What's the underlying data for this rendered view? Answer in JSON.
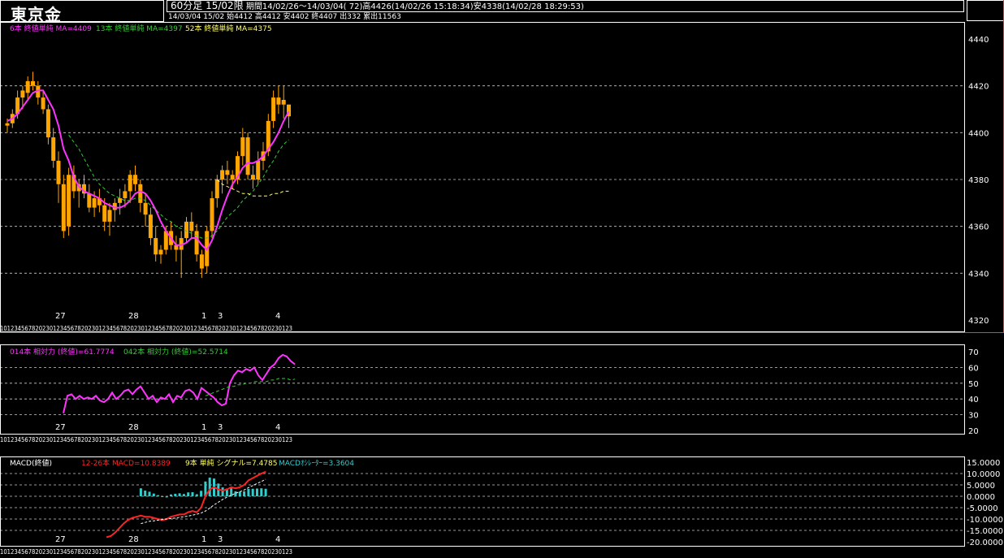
{
  "header": {
    "title": "東京金",
    "timeframe": "60分足 15/02限",
    "period_info": "期間14/02/26〜14/03/04( 72)高4426(14/02/26 15:18:34)安4338(14/02/28 18:29:53)",
    "bar_info": "14/03/04 15/02 始4412 高4412 安4402 終4407 出332 累出11563"
  },
  "colors": {
    "background": "#000000",
    "candle": "#ffa500",
    "ma6": "#ff33ff",
    "ma13": "#33cc33",
    "ma52": "#ffff66",
    "grid": "#ffffff",
    "panel_border_main": "#ff3333",
    "macd_line": "#ff2222",
    "signal_line": "#ffffff",
    "osc_bar": "#33cccc"
  },
  "main_panel": {
    "legend": {
      "ma6": "6本 終値単純 MA=4409",
      "ma13": "13本 終値単純 MA=4397",
      "ma52": "52本 終値単純 MA=4375"
    },
    "y_labels": [
      "4440",
      "4420",
      "4400",
      "4380",
      "4360",
      "4340",
      "4320"
    ],
    "date_labels": [
      "27",
      "28",
      "1",
      "3",
      "4"
    ],
    "hour_strip": "10123456782023012345678202301234567820230123456782023012345678202301234567820230123"
  },
  "rsi_panel": {
    "legend": {
      "rsi14": "014本 相対力 (終値)=61.7774",
      "rsi42": "042本 相対力 (終値)=52.5714"
    },
    "y_labels": [
      "70",
      "60",
      "50",
      "40",
      "30",
      "20"
    ],
    "date_labels": [
      "27",
      "28",
      "1",
      "3",
      "4"
    ]
  },
  "macd_panel": {
    "legend": {
      "name": "MACD(終値)",
      "macd": "12-26本 MACD=10.8389",
      "signal": "9本 単純 シグナル=7.4785",
      "osc": "MACDｵｼﾚｰﾀｰ=3.3604"
    },
    "y_labels": [
      "15.0000",
      "10.0000",
      "5.0000",
      "0.0000",
      "-5.0000",
      "-10.0000",
      "-15.0000",
      "-20.0000"
    ],
    "date_labels": [
      "27",
      "28",
      "1",
      "3",
      "4"
    ]
  },
  "chart_data": [
    {
      "type": "candlestick",
      "title": "東京金 60分足 15/02限",
      "ylim": [
        4320,
        4450
      ],
      "grid": true,
      "candles": [
        {
          "o": 4403,
          "h": 4406,
          "l": 4400,
          "c": 4404
        },
        {
          "o": 4404,
          "h": 4410,
          "l": 4402,
          "c": 4408
        },
        {
          "o": 4408,
          "h": 4418,
          "l": 4406,
          "c": 4415
        },
        {
          "o": 4415,
          "h": 4420,
          "l": 4410,
          "c": 4418
        },
        {
          "o": 4417,
          "h": 4424,
          "l": 4414,
          "c": 4422
        },
        {
          "o": 4422,
          "h": 4426,
          "l": 4418,
          "c": 4420
        },
        {
          "o": 4420,
          "h": 4422,
          "l": 4412,
          "c": 4415
        },
        {
          "o": 4415,
          "h": 4418,
          "l": 4408,
          "c": 4410
        },
        {
          "o": 4410,
          "h": 4412,
          "l": 4395,
          "c": 4398
        },
        {
          "o": 4398,
          "h": 4402,
          "l": 4385,
          "c": 4388
        },
        {
          "o": 4388,
          "h": 4392,
          "l": 4370,
          "c": 4378
        },
        {
          "o": 4378,
          "h": 4382,
          "l": 4355,
          "c": 4358
        },
        {
          "o": 4360,
          "h": 4385,
          "l": 4356,
          "c": 4382
        },
        {
          "o": 4382,
          "h": 4386,
          "l": 4372,
          "c": 4375
        },
        {
          "o": 4375,
          "h": 4380,
          "l": 4368,
          "c": 4378
        },
        {
          "o": 4378,
          "h": 4382,
          "l": 4372,
          "c": 4374
        },
        {
          "o": 4374,
          "h": 4378,
          "l": 4366,
          "c": 4368
        },
        {
          "o": 4368,
          "h": 4375,
          "l": 4364,
          "c": 4372
        },
        {
          "o": 4372,
          "h": 4376,
          "l": 4366,
          "c": 4369
        },
        {
          "o": 4369,
          "h": 4372,
          "l": 4358,
          "c": 4362
        },
        {
          "o": 4362,
          "h": 4370,
          "l": 4356,
          "c": 4367
        },
        {
          "o": 4367,
          "h": 4372,
          "l": 4362,
          "c": 4370
        },
        {
          "o": 4370,
          "h": 4376,
          "l": 4365,
          "c": 4372
        },
        {
          "o": 4372,
          "h": 4378,
          "l": 4368,
          "c": 4375
        },
        {
          "o": 4375,
          "h": 4384,
          "l": 4370,
          "c": 4382
        },
        {
          "o": 4382,
          "h": 4386,
          "l": 4375,
          "c": 4378
        },
        {
          "o": 4378,
          "h": 4380,
          "l": 4366,
          "c": 4370
        },
        {
          "o": 4370,
          "h": 4374,
          "l": 4360,
          "c": 4365
        },
        {
          "o": 4365,
          "h": 4368,
          "l": 4352,
          "c": 4355
        },
        {
          "o": 4355,
          "h": 4360,
          "l": 4345,
          "c": 4348
        },
        {
          "o": 4348,
          "h": 4352,
          "l": 4344,
          "c": 4350
        },
        {
          "o": 4350,
          "h": 4360,
          "l": 4348,
          "c": 4358
        },
        {
          "o": 4358,
          "h": 4362,
          "l": 4350,
          "c": 4352
        },
        {
          "o": 4352,
          "h": 4356,
          "l": 4345,
          "c": 4350
        },
        {
          "o": 4350,
          "h": 4358,
          "l": 4338,
          "c": 4355
        },
        {
          "o": 4355,
          "h": 4364,
          "l": 4353,
          "c": 4362
        },
        {
          "o": 4362,
          "h": 4366,
          "l": 4355,
          "c": 4358
        },
        {
          "o": 4358,
          "h": 4361,
          "l": 4345,
          "c": 4348
        },
        {
          "o": 4348,
          "h": 4350,
          "l": 4338,
          "c": 4342
        },
        {
          "o": 4343,
          "h": 4360,
          "l": 4340,
          "c": 4358
        },
        {
          "o": 4358,
          "h": 4375,
          "l": 4355,
          "c": 4372
        },
        {
          "o": 4372,
          "h": 4382,
          "l": 4368,
          "c": 4380
        },
        {
          "o": 4380,
          "h": 4386,
          "l": 4374,
          "c": 4384
        },
        {
          "o": 4384,
          "h": 4388,
          "l": 4378,
          "c": 4382
        },
        {
          "o": 4382,
          "h": 4384,
          "l": 4376,
          "c": 4380
        },
        {
          "o": 4380,
          "h": 4392,
          "l": 4378,
          "c": 4390
        },
        {
          "o": 4390,
          "h": 4402,
          "l": 4386,
          "c": 4398
        },
        {
          "o": 4398,
          "h": 4400,
          "l": 4380,
          "c": 4382
        },
        {
          "o": 4382,
          "h": 4386,
          "l": 4376,
          "c": 4380
        },
        {
          "o": 4380,
          "h": 4392,
          "l": 4378,
          "c": 4388
        },
        {
          "o": 4388,
          "h": 4396,
          "l": 4384,
          "c": 4392
        },
        {
          "o": 4392,
          "h": 4408,
          "l": 4390,
          "c": 4405
        },
        {
          "o": 4405,
          "h": 4418,
          "l": 4402,
          "c": 4415
        },
        {
          "o": 4415,
          "h": 4420,
          "l": 4408,
          "c": 4412
        },
        {
          "o": 4412,
          "h": 4420,
          "l": 4406,
          "c": 4414
        },
        {
          "o": 4412,
          "h": 4412,
          "l": 4402,
          "c": 4407
        }
      ],
      "series": [
        {
          "name": "6本 終値単純 MA",
          "values": [
            4405,
            4406,
            4408,
            4411,
            4414,
            4417,
            4418,
            4418,
            4414,
            4410,
            4403,
            4393,
            4388,
            4381,
            4377,
            4375,
            4374,
            4373,
            4372,
            4370,
            4369,
            4368,
            4368,
            4369,
            4371,
            4374,
            4375,
            4374,
            4371,
            4367,
            4362,
            4358,
            4355,
            4352,
            4352,
            4353,
            4355,
            4355,
            4352,
            4350,
            4354,
            4360,
            4367,
            4373,
            4378,
            4381,
            4385,
            4387,
            4387,
            4388,
            4390,
            4393,
            4396,
            4400,
            4405,
            4409
          ]
        },
        {
          "name": "13本 終値単純 MA",
          "values": [
            null,
            null,
            null,
            null,
            null,
            null,
            null,
            null,
            null,
            null,
            null,
            null,
            4399,
            4396,
            4393,
            4389,
            4385,
            4381,
            4378,
            4376,
            4374,
            4373,
            4372,
            4371,
            4371,
            4372,
            4372,
            4371,
            4369,
            4367,
            4365,
            4363,
            4362,
            4360,
            4359,
            4358,
            4357,
            4356,
            4355,
            4355,
            4356,
            4358,
            4361,
            4364,
            4366,
            4368,
            4371,
            4373,
            4375,
            4378,
            4381,
            4385,
            4388,
            4392,
            4395,
            4397
          ]
        },
        {
          "name": "52本 終値単純 MA",
          "values": [
            null,
            null,
            null,
            null,
            null,
            null,
            null,
            null,
            null,
            null,
            null,
            null,
            null,
            null,
            null,
            null,
            null,
            null,
            null,
            null,
            null,
            null,
            null,
            null,
            null,
            null,
            null,
            null,
            null,
            null,
            null,
            null,
            null,
            null,
            null,
            null,
            null,
            null,
            null,
            null,
            null,
            4380,
            4378,
            4377,
            4376,
            4375,
            4374,
            4374,
            4373,
            4373,
            4373,
            4373,
            4374,
            4374,
            4375,
            4375
          ]
        }
      ]
    },
    {
      "type": "line",
      "title": "相対力 (終値)",
      "ylim": [
        20,
        70
      ],
      "grid": true,
      "series": [
        {
          "name": "014本 相対力 (終値)",
          "values": [
            null,
            null,
            null,
            null,
            null,
            null,
            null,
            null,
            null,
            null,
            null,
            null,
            null,
            null,
            31,
            42,
            43,
            40,
            42,
            40,
            41,
            40,
            42,
            39,
            38,
            40,
            44,
            40,
            42,
            45,
            46,
            43,
            46,
            48,
            44,
            40,
            42,
            38,
            41,
            40,
            43,
            38,
            42,
            41,
            45,
            46,
            44,
            40,
            47,
            45,
            43,
            41,
            38,
            36,
            37,
            50,
            55,
            58,
            57,
            59,
            58,
            60,
            55,
            52,
            56,
            60,
            62,
            66,
            68,
            67,
            64,
            62
          ]
        },
        {
          "name": "042本 相対力 (終値)",
          "values": [
            null,
            null,
            null,
            null,
            null,
            null,
            null,
            null,
            null,
            null,
            null,
            null,
            null,
            null,
            null,
            null,
            null,
            null,
            null,
            null,
            null,
            null,
            null,
            null,
            null,
            null,
            null,
            null,
            null,
            null,
            null,
            null,
            null,
            null,
            null,
            null,
            null,
            null,
            null,
            null,
            null,
            null,
            null,
            null,
            null,
            null,
            null,
            null,
            null,
            42,
            43,
            44,
            45,
            46,
            47,
            48,
            48,
            49,
            49,
            50,
            50,
            51,
            51,
            51,
            51,
            52,
            52,
            53,
            53,
            53,
            52,
            52.6
          ]
        }
      ]
    },
    {
      "type": "line",
      "title": "MACD(終値)",
      "ylim": [
        -20,
        15
      ],
      "grid": true,
      "series": [
        {
          "name": "12-26本 MACD",
          "values": [
            null,
            null,
            null,
            null,
            null,
            null,
            null,
            null,
            null,
            null,
            null,
            null,
            null,
            null,
            null,
            null,
            null,
            null,
            null,
            null,
            null,
            null,
            null,
            null,
            null,
            null,
            null,
            null,
            null,
            null,
            -18,
            -17.5,
            -16,
            -14,
            -12,
            -10.5,
            -9.5,
            -9,
            -8.5,
            -9,
            -9,
            -9.5,
            -10,
            -10.5,
            -10,
            -9,
            -8.5,
            -8,
            -8,
            -7,
            -6.5,
            -7,
            -5,
            0,
            3,
            4,
            3,
            2.5,
            3,
            4,
            3.5,
            4,
            5,
            7,
            8,
            9,
            10,
            10.8
          ]
        },
        {
          "name": "9本 単純 シグナル",
          "values": [
            null,
            null,
            null,
            null,
            null,
            null,
            null,
            null,
            null,
            null,
            null,
            null,
            null,
            null,
            null,
            null,
            null,
            null,
            null,
            null,
            null,
            null,
            null,
            null,
            null,
            null,
            null,
            null,
            null,
            null,
            null,
            null,
            null,
            null,
            null,
            null,
            null,
            null,
            -12,
            -11.5,
            -11,
            -10.8,
            -10.5,
            -10.2,
            -10,
            -9.8,
            -9.6,
            -9.3,
            -9,
            -8.7,
            -8.3,
            -7.9,
            -7.4,
            -6.5,
            -5.2,
            -3.8,
            -2.6,
            -1.4,
            -0.4,
            0.5,
            1.3,
            2,
            2.8,
            3.8,
            4.7,
            5.6,
            6.5,
            7.5
          ]
        },
        {
          "name": "MACDｵｼﾚｰﾀｰ",
          "values": [
            null,
            null,
            null,
            null,
            null,
            null,
            null,
            null,
            null,
            null,
            null,
            null,
            null,
            null,
            null,
            null,
            null,
            null,
            null,
            null,
            null,
            null,
            null,
            null,
            null,
            null,
            null,
            null,
            null,
            null,
            null,
            null,
            null,
            null,
            null,
            null,
            null,
            null,
            3.5,
            2.5,
            2,
            1.2,
            0.5,
            -0.3,
            -0.5,
            0.8,
            1.1,
            1.3,
            1.0,
            1.7,
            1.8,
            0.9,
            2.4,
            6.5,
            8.2,
            7.8,
            5.6,
            3.9,
            3.4,
            3.5,
            2.2,
            2.0,
            2.2,
            3.2,
            3.3,
            3.4,
            3.5,
            3.3
          ]
        }
      ]
    }
  ]
}
